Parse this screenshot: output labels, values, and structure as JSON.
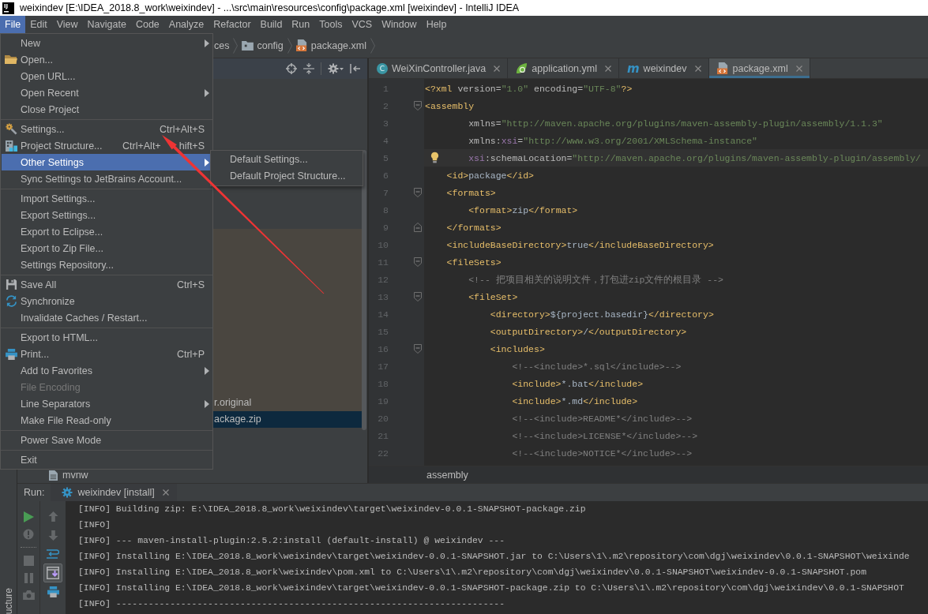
{
  "window": {
    "logo_text": "IJ",
    "title": "weixindev [E:\\IDEA_2018.8_work\\weixindev] - ...\\src\\main\\resources\\config\\package.xml [weixindev] - IntelliJ IDEA"
  },
  "menu_bar": [
    {
      "label": "File",
      "selected": true
    },
    {
      "label": "Edit",
      "selected": false
    },
    {
      "label": "View",
      "selected": false
    },
    {
      "label": "Navigate",
      "selected": false
    },
    {
      "label": "Code",
      "selected": false
    },
    {
      "label": "Analyze",
      "selected": false
    },
    {
      "label": "Refactor",
      "selected": false
    },
    {
      "label": "Build",
      "selected": false
    },
    {
      "label": "Run",
      "selected": false
    },
    {
      "label": "Tools",
      "selected": false
    },
    {
      "label": "VCS",
      "selected": false
    },
    {
      "label": "Window",
      "selected": false
    },
    {
      "label": "Help",
      "selected": false
    }
  ],
  "file_menu": {
    "items": [
      {
        "kind": "item",
        "label": "New",
        "submenu": true,
        "disabled": false,
        "selected": false
      },
      {
        "kind": "item",
        "label": "Open...",
        "submenu": false,
        "disabled": false,
        "selected": false
      },
      {
        "kind": "item",
        "label": "Open URL...",
        "submenu": false,
        "disabled": false,
        "selected": false
      },
      {
        "kind": "item",
        "label": "Open Recent",
        "submenu": true,
        "disabled": false,
        "selected": false
      },
      {
        "kind": "item",
        "label": "Close Project",
        "submenu": false,
        "disabled": false,
        "selected": false
      },
      {
        "kind": "separator"
      },
      {
        "kind": "item",
        "label": "Settings...",
        "shortcut": "Ctrl+Alt+S",
        "submenu": false,
        "disabled": false,
        "selected": false
      },
      {
        "kind": "item",
        "label": "Project Structure...",
        "shortcut_parts": [
          "Ctrl+Alt+",
          "hift+S"
        ],
        "submenu": false,
        "disabled": false,
        "selected": false
      },
      {
        "kind": "item",
        "label": "Other Settings",
        "submenu": true,
        "disabled": false,
        "selected": true
      },
      {
        "kind": "item",
        "label": "Sync Settings to JetBrains Account...",
        "submenu": false,
        "disabled": false,
        "selected": false
      },
      {
        "kind": "separator"
      },
      {
        "kind": "item",
        "label": "Import Settings...",
        "submenu": false,
        "disabled": false,
        "selected": false
      },
      {
        "kind": "item",
        "label": "Export Settings...",
        "submenu": false,
        "disabled": false,
        "selected": false
      },
      {
        "kind": "item",
        "label": "Export to Eclipse...",
        "submenu": false,
        "disabled": false,
        "selected": false
      },
      {
        "kind": "item",
        "label": "Export to Zip File...",
        "submenu": false,
        "disabled": false,
        "selected": false
      },
      {
        "kind": "item",
        "label": "Settings Repository...",
        "submenu": false,
        "disabled": false,
        "selected": false
      },
      {
        "kind": "separator"
      },
      {
        "kind": "item",
        "label": "Save All",
        "shortcut": "Ctrl+S",
        "submenu": false,
        "disabled": false,
        "selected": false
      },
      {
        "kind": "item",
        "label": "Synchronize",
        "submenu": false,
        "disabled": false,
        "selected": false
      },
      {
        "kind": "item",
        "label": "Invalidate Caches / Restart...",
        "submenu": false,
        "disabled": false,
        "selected": false
      },
      {
        "kind": "separator"
      },
      {
        "kind": "item",
        "label": "Export to HTML...",
        "submenu": false,
        "disabled": false,
        "selected": false
      },
      {
        "kind": "item",
        "label": "Print...",
        "shortcut": "Ctrl+P",
        "submenu": false,
        "disabled": false,
        "selected": false
      },
      {
        "kind": "item",
        "label": "Add to Favorites",
        "submenu": true,
        "disabled": false,
        "selected": false
      },
      {
        "kind": "item",
        "label": "File Encoding",
        "submenu": false,
        "disabled": true,
        "selected": false
      },
      {
        "kind": "item",
        "label": "Line Separators",
        "submenu": true,
        "disabled": false,
        "selected": false
      },
      {
        "kind": "item",
        "label": "Make File Read-only",
        "submenu": false,
        "disabled": false,
        "selected": false
      },
      {
        "kind": "separator"
      },
      {
        "kind": "item",
        "label": "Power Save Mode",
        "submenu": false,
        "disabled": false,
        "selected": false
      },
      {
        "kind": "separator"
      },
      {
        "kind": "item",
        "label": "Exit",
        "submenu": false,
        "disabled": false,
        "selected": false
      }
    ]
  },
  "submenu": [
    "Default Settings...",
    "Default Project Structure..."
  ],
  "navigation_bar": {
    "crumbs": [
      "ces",
      "config",
      "package.xml"
    ]
  },
  "project_panel": {
    "rows": [
      {
        "label": "r.original",
        "selected": false
      },
      {
        "label": "ackage.zip",
        "selected": true
      }
    ],
    "file": {
      "label": "mvnw"
    }
  },
  "editor": {
    "tabs": [
      {
        "kind": "java",
        "icon_text": "C",
        "label": "WeiXinController.java",
        "selected": false
      },
      {
        "kind": "yml",
        "label": "application.yml",
        "selected": false
      },
      {
        "kind": "maven",
        "icon_text": "m",
        "label": "weixindev",
        "selected": false
      },
      {
        "kind": "xml",
        "label": "package.xml",
        "selected": true
      }
    ],
    "lines": [
      {
        "number": "1",
        "fold_start": false,
        "fold_end": false,
        "current": false,
        "bulb": false,
        "segments": [
          {
            "kind": "tag",
            "text": "<?xml"
          },
          {
            "kind": "attr",
            "text": " version="
          },
          {
            "kind": "value",
            "text": "\"1.0\""
          },
          {
            "kind": "attr",
            "text": " encoding="
          },
          {
            "kind": "value",
            "text": "\"UTF-8\""
          },
          {
            "kind": "tag",
            "text": "?>"
          }
        ]
      },
      {
        "number": "2",
        "fold_start": true,
        "fold_end": false,
        "current": false,
        "bulb": false,
        "segments": [
          {
            "kind": "tag",
            "text": "<assembly"
          }
        ]
      },
      {
        "number": "3",
        "fold_start": false,
        "fold_end": false,
        "current": false,
        "bulb": false,
        "segments": [
          {
            "kind": "attr",
            "text": "        xmlns="
          },
          {
            "kind": "value",
            "text": "\"http://maven.apache.org/plugins/maven-assembly-plugin/assembly/1.1.3\""
          }
        ]
      },
      {
        "number": "4",
        "fold_start": false,
        "fold_end": false,
        "current": false,
        "bulb": false,
        "segments": [
          {
            "kind": "attr",
            "text": "        xmlns:"
          },
          {
            "kind": "ns",
            "text": "xsi"
          },
          {
            "kind": "attr",
            "text": "="
          },
          {
            "kind": "value",
            "text": "\"http://www.w3.org/2001/XMLSchema-instance\""
          }
        ]
      },
      {
        "number": "5",
        "fold_start": false,
        "fold_end": false,
        "current": true,
        "bulb": true,
        "segments": [
          {
            "kind": "ns",
            "text": "        xsi"
          },
          {
            "kind": "attr",
            "text": ":schemaLocation="
          },
          {
            "kind": "value",
            "text": "\"http://maven.apache.org/plugins/maven-assembly-plugin/assembly/"
          }
        ]
      },
      {
        "number": "6",
        "fold_start": false,
        "fold_end": false,
        "current": false,
        "bulb": false,
        "segments": [
          {
            "kind": "tag",
            "text": "    <id>"
          },
          {
            "kind": "text",
            "text": "package"
          },
          {
            "kind": "tag",
            "text": "</id>"
          }
        ]
      },
      {
        "number": "7",
        "fold_start": true,
        "fold_end": false,
        "current": false,
        "bulb": false,
        "segments": [
          {
            "kind": "tag",
            "text": "    <formats>"
          }
        ]
      },
      {
        "number": "8",
        "fold_start": false,
        "fold_end": false,
        "current": false,
        "bulb": false,
        "segments": [
          {
            "kind": "tag",
            "text": "        <format>"
          },
          {
            "kind": "text",
            "text": "zip"
          },
          {
            "kind": "tag",
            "text": "</format>"
          }
        ]
      },
      {
        "number": "9",
        "fold_start": false,
        "fold_end": true,
        "current": false,
        "bulb": false,
        "segments": [
          {
            "kind": "tag",
            "text": "    </formats>"
          }
        ]
      },
      {
        "number": "10",
        "fold_start": false,
        "fold_end": false,
        "current": false,
        "bulb": false,
        "segments": [
          {
            "kind": "tag",
            "text": "    <includeBaseDirectory>"
          },
          {
            "kind": "text",
            "text": "true"
          },
          {
            "kind": "tag",
            "text": "</includeBaseDirectory>"
          }
        ]
      },
      {
        "number": "11",
        "fold_start": true,
        "fold_end": false,
        "current": false,
        "bulb": false,
        "segments": [
          {
            "kind": "tag",
            "text": "    <fileSets>"
          }
        ]
      },
      {
        "number": "12",
        "fold_start": false,
        "fold_end": false,
        "current": false,
        "bulb": false,
        "segments": [
          {
            "kind": "comment",
            "text": "        <!-- 把项目相关的说明文件，打包进zip文件的根目录 -->"
          }
        ]
      },
      {
        "number": "13",
        "fold_start": true,
        "fold_end": false,
        "current": false,
        "bulb": false,
        "segments": [
          {
            "kind": "tag",
            "text": "        <fileSet>"
          }
        ]
      },
      {
        "number": "14",
        "fold_start": false,
        "fold_end": false,
        "current": false,
        "bulb": false,
        "segments": [
          {
            "kind": "tag",
            "text": "            <directory>"
          },
          {
            "kind": "text",
            "text": "${project.basedir}"
          },
          {
            "kind": "tag",
            "text": "</directory>"
          }
        ]
      },
      {
        "number": "15",
        "fold_start": false,
        "fold_end": false,
        "current": false,
        "bulb": false,
        "segments": [
          {
            "kind": "tag",
            "text": "            <outputDirectory>"
          },
          {
            "kind": "text",
            "text": "/"
          },
          {
            "kind": "tag",
            "text": "</outputDirectory>"
          }
        ]
      },
      {
        "number": "16",
        "fold_start": true,
        "fold_end": false,
        "current": false,
        "bulb": false,
        "segments": [
          {
            "kind": "tag",
            "text": "            <includes>"
          }
        ]
      },
      {
        "number": "17",
        "fold_start": false,
        "fold_end": false,
        "current": false,
        "bulb": false,
        "segments": [
          {
            "kind": "comment",
            "text": "                <!--<include>*.sql</include>-->"
          }
        ]
      },
      {
        "number": "18",
        "fold_start": false,
        "fold_end": false,
        "current": false,
        "bulb": false,
        "segments": [
          {
            "kind": "tag",
            "text": "                <include>"
          },
          {
            "kind": "text",
            "text": "*.bat"
          },
          {
            "kind": "tag",
            "text": "</include>"
          }
        ]
      },
      {
        "number": "19",
        "fold_start": false,
        "fold_end": false,
        "current": false,
        "bulb": false,
        "segments": [
          {
            "kind": "tag",
            "text": "                <include>"
          },
          {
            "kind": "text",
            "text": "*.md"
          },
          {
            "kind": "tag",
            "text": "</include>"
          }
        ]
      },
      {
        "number": "20",
        "fold_start": false,
        "fold_end": false,
        "current": false,
        "bulb": false,
        "segments": [
          {
            "kind": "comment",
            "text": "                <!--<include>README*</include>-->"
          }
        ]
      },
      {
        "number": "21",
        "fold_start": false,
        "fold_end": false,
        "current": false,
        "bulb": false,
        "segments": [
          {
            "kind": "comment",
            "text": "                <!--<include>LICENSE*</include>-->"
          }
        ]
      },
      {
        "number": "22",
        "fold_start": false,
        "fold_end": false,
        "current": false,
        "bulb": false,
        "segments": [
          {
            "kind": "comment",
            "text": "                <!--<include>NOTICE*</include>-->"
          }
        ]
      }
    ],
    "breadcrumb": "assembly"
  },
  "run_panel": {
    "label": "Run:",
    "tab": "weixindev [install]",
    "left_toolbar": [
      {
        "disabled": false
      },
      {
        "disabled": true
      },
      {
        "disabled": true
      },
      {
        "disabled": true
      },
      {
        "disabled": true
      }
    ],
    "right_toolbar": [
      {
        "disabled": true,
        "selected": false
      },
      {
        "disabled": true,
        "selected": false
      },
      {
        "disabled": false,
        "selected": false
      },
      {
        "disabled": false,
        "selected": true
      },
      {
        "disabled": false,
        "selected": false
      }
    ],
    "console": [
      "[INFO] Building zip: E:\\IDEA_2018.8_work\\weixindev\\target\\weixindev-0.0.1-SNAPSHOT-package.zip",
      "[INFO]",
      "[INFO] --- maven-install-plugin:2.5.2:install (default-install) @ weixindev ---",
      "[INFO] Installing E:\\IDEA_2018.8_work\\weixindev\\target\\weixindev-0.0.1-SNAPSHOT.jar to C:\\Users\\1\\.m2\\repository\\com\\dgj\\weixindev\\0.0.1-SNAPSHOT\\weixinde",
      "[INFO] Installing E:\\IDEA_2018.8_work\\weixindev\\pom.xml to C:\\Users\\1\\.m2\\repository\\com\\dgj\\weixindev\\0.0.1-SNAPSHOT\\weixindev-0.0.1-SNAPSHOT.pom",
      "[INFO] Installing E:\\IDEA_2018.8_work\\weixindev\\target\\weixindev-0.0.1-SNAPSHOT-package.zip to C:\\Users\\1\\.m2\\repository\\com\\dgj\\weixindev\\0.0.1-SNAPSHOT",
      "[INFO] ------------------------------------------------------------------------"
    ]
  },
  "tool_strip": {
    "label": "ucture"
  }
}
